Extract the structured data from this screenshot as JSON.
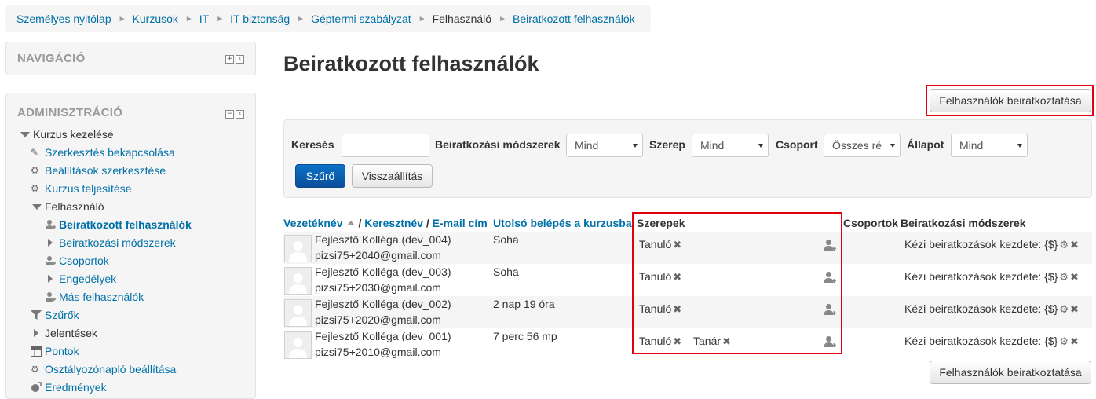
{
  "breadcrumb": [
    {
      "label": "Személyes nyitólap",
      "link": true
    },
    {
      "label": "Kurzusok",
      "link": true
    },
    {
      "label": "IT",
      "link": true
    },
    {
      "label": "IT biztonság",
      "link": true
    },
    {
      "label": "Géptermi szabályzat",
      "link": true
    },
    {
      "label": "Felhasználó",
      "link": false
    },
    {
      "label": "Beiratkozott felhasználók",
      "link": true
    }
  ],
  "navigation": {
    "title": "NAVIGÁCIÓ"
  },
  "administration": {
    "title": "ADMINISZTRÁCIÓ",
    "items": [
      {
        "label": "Kurzus kezelése",
        "icon": "caret-down-icon"
      },
      {
        "label": "Szerkesztés bekapcsolása",
        "icon": "pencil-icon"
      },
      {
        "label": "Beállítások szerkesztése",
        "icon": "gear-icon"
      },
      {
        "label": "Kurzus teljesítése",
        "icon": "gear-icon"
      },
      {
        "label": "Felhasználó",
        "icon": "caret-down-icon"
      },
      {
        "label": "Beiratkozott felhasználók",
        "icon": "user-icon"
      },
      {
        "label": "Beiratkozási módszerek",
        "icon": "caret-right-icon"
      },
      {
        "label": "Csoportok",
        "icon": "user-icon"
      },
      {
        "label": "Engedélyek",
        "icon": "caret-right-icon"
      },
      {
        "label": "Más felhasználók",
        "icon": "user-icon"
      },
      {
        "label": "Szűrők",
        "icon": "filter-icon"
      },
      {
        "label": "Jelentések",
        "icon": "caret-right-icon"
      },
      {
        "label": "Pontok",
        "icon": "table-icon"
      },
      {
        "label": "Osztályozónapló beállítása",
        "icon": "gear-icon"
      },
      {
        "label": "Eredmények",
        "icon": "trophy-icon"
      }
    ]
  },
  "page": {
    "title": "Beiratkozott felhasználók",
    "enrol_button": "Felhasználók beiratkoztatása"
  },
  "filters": {
    "search_label": "Keresés",
    "search_value": "",
    "methods_label": "Beiratkozási módszerek",
    "methods_value": "Mind",
    "role_label": "Szerep",
    "role_value": "Mind",
    "group_label": "Csoport",
    "group_value": "Összes ré",
    "status_label": "Állapot",
    "status_value": "Mind",
    "filter_button": "Szűrő",
    "reset_button": "Visszaállítás"
  },
  "table": {
    "headers": {
      "lastname": "Vezetéknév",
      "firstname": "Keresztnév",
      "email": "E-mail cím",
      "lastaccess": "Utolsó belépés a kurzusba",
      "roles": "Szerepek",
      "groups": "Csoportok",
      "methods": "Beiratkozási módszerek"
    },
    "rows": [
      {
        "name": "Fejlesztő Kolléga (dev_004)",
        "email": "pizsi75+2040@gmail.com",
        "lastaccess": "Soha",
        "roles": [
          "Tanuló"
        ],
        "method": "Kézi beiratkozások kezdete: {$}"
      },
      {
        "name": "Fejlesztő Kolléga (dev_003)",
        "email": "pizsi75+2030@gmail.com",
        "lastaccess": "Soha",
        "roles": [
          "Tanuló"
        ],
        "method": "Kézi beiratkozások kezdete: {$}"
      },
      {
        "name": "Fejlesztő Kolléga (dev_002)",
        "email": "pizsi75+2020@gmail.com",
        "lastaccess": "2 nap 19 óra",
        "roles": [
          "Tanuló"
        ],
        "method": "Kézi beiratkozások kezdete: {$}"
      },
      {
        "name": "Fejlesztő Kolléga (dev_001)",
        "email": "pizsi75+2010@gmail.com",
        "lastaccess": "7 perc 56 mp",
        "roles": [
          "Tanuló",
          "Tanár"
        ],
        "method": "Kézi beiratkozások kezdete: {$}"
      }
    ]
  },
  "colors": {
    "link": "#0070a8",
    "highlight": "#e0000f",
    "primary": "#0b5fb0"
  }
}
